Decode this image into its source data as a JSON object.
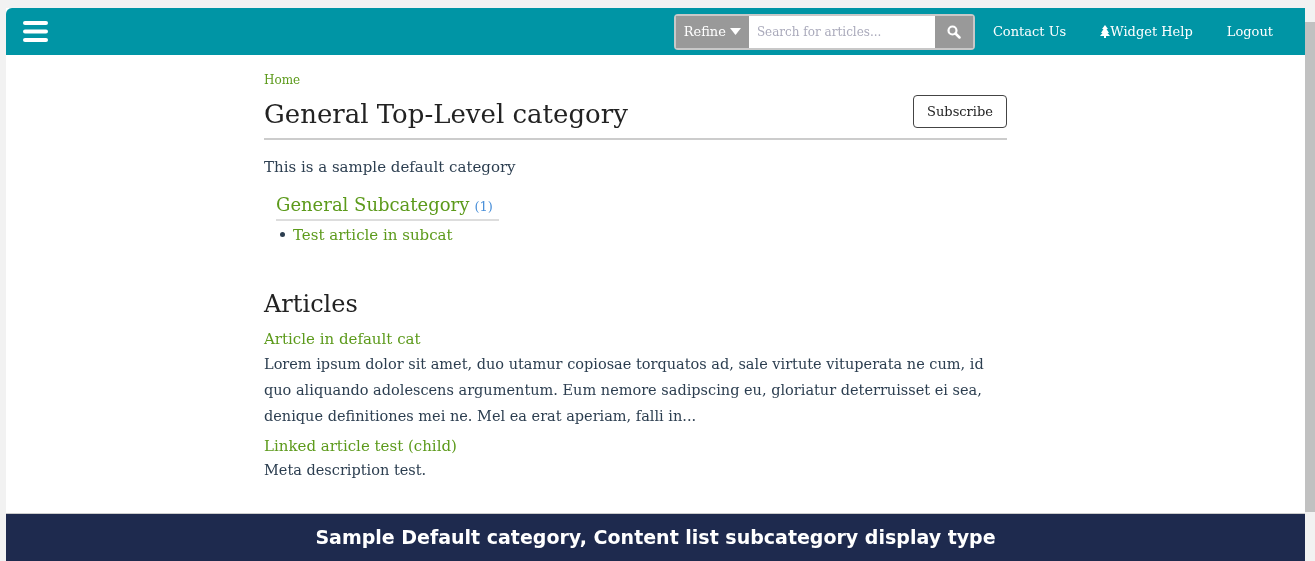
{
  "header": {
    "refine": {
      "label": "Refine"
    },
    "search": {
      "placeholder": "Search for articles..."
    },
    "links": [
      {
        "label": "Contact Us",
        "kind": "plain"
      },
      {
        "label": "Widget Help",
        "kind": "icon"
      },
      {
        "label": "Logout",
        "kind": "plain"
      }
    ]
  },
  "breadcrumb": [
    "Home"
  ],
  "title": "General Top-Level category",
  "subscribe": "Subscribe",
  "description": "This is a sample default category",
  "subcategories": [
    {
      "name": "General Subcategory",
      "count": "(1)",
      "articles": [
        "Test article in subcat"
      ]
    }
  ],
  "articles_heading": "Articles",
  "articles": [
    {
      "title": "Article in default cat",
      "summary": "Lorem ipsum dolor sit amet, duo utamur copiosae torquatos ad, sale virtute vituperata ne cum, id quo aliquando adolescens argumentum. Eum nemore sadipscing eu, gloriatur deterruisset ei sea, denique definitiones mei ne. Mel ea erat aperiam, falli in..."
    },
    {
      "title": "Linked article test (child)",
      "summary": "Meta description test."
    }
  ],
  "footer": "Sample Default category, Content list subcategory display type"
}
